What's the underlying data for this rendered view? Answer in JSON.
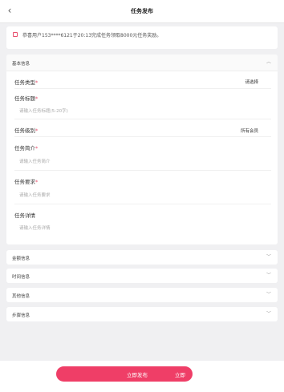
{
  "header": {
    "back_icon": "‹",
    "title": "任务发布"
  },
  "notice": {
    "text": "恭喜用户153****6121于20:13完成任务领取8000元任务奖励。"
  },
  "basic_section": {
    "title": "基本信息",
    "fields": {
      "task_type": {
        "label": "任务类型",
        "value": "请选择"
      },
      "task_title": {
        "label": "任务标题",
        "placeholder": "请输入任务标题(5-20字)"
      },
      "task_level": {
        "label": "任务级别",
        "value": "所有会员"
      },
      "task_brief": {
        "label": "任务简介",
        "placeholder": "请输入任务简介"
      },
      "task_requirement": {
        "label": "任务要求",
        "placeholder": "请输入任务要求"
      },
      "task_detail": {
        "label": "任务详情",
        "placeholder": "请输入任务详情"
      }
    }
  },
  "sections": {
    "amount": "金额信息",
    "time": "时间信息",
    "other": "其他信息",
    "steps": "步骤信息"
  },
  "publish": {
    "label": "立即发布",
    "label_overflow": "立即"
  },
  "colors": {
    "accent": "#ef3e67",
    "required": "#e8506e",
    "background": "#f0f0f2"
  }
}
